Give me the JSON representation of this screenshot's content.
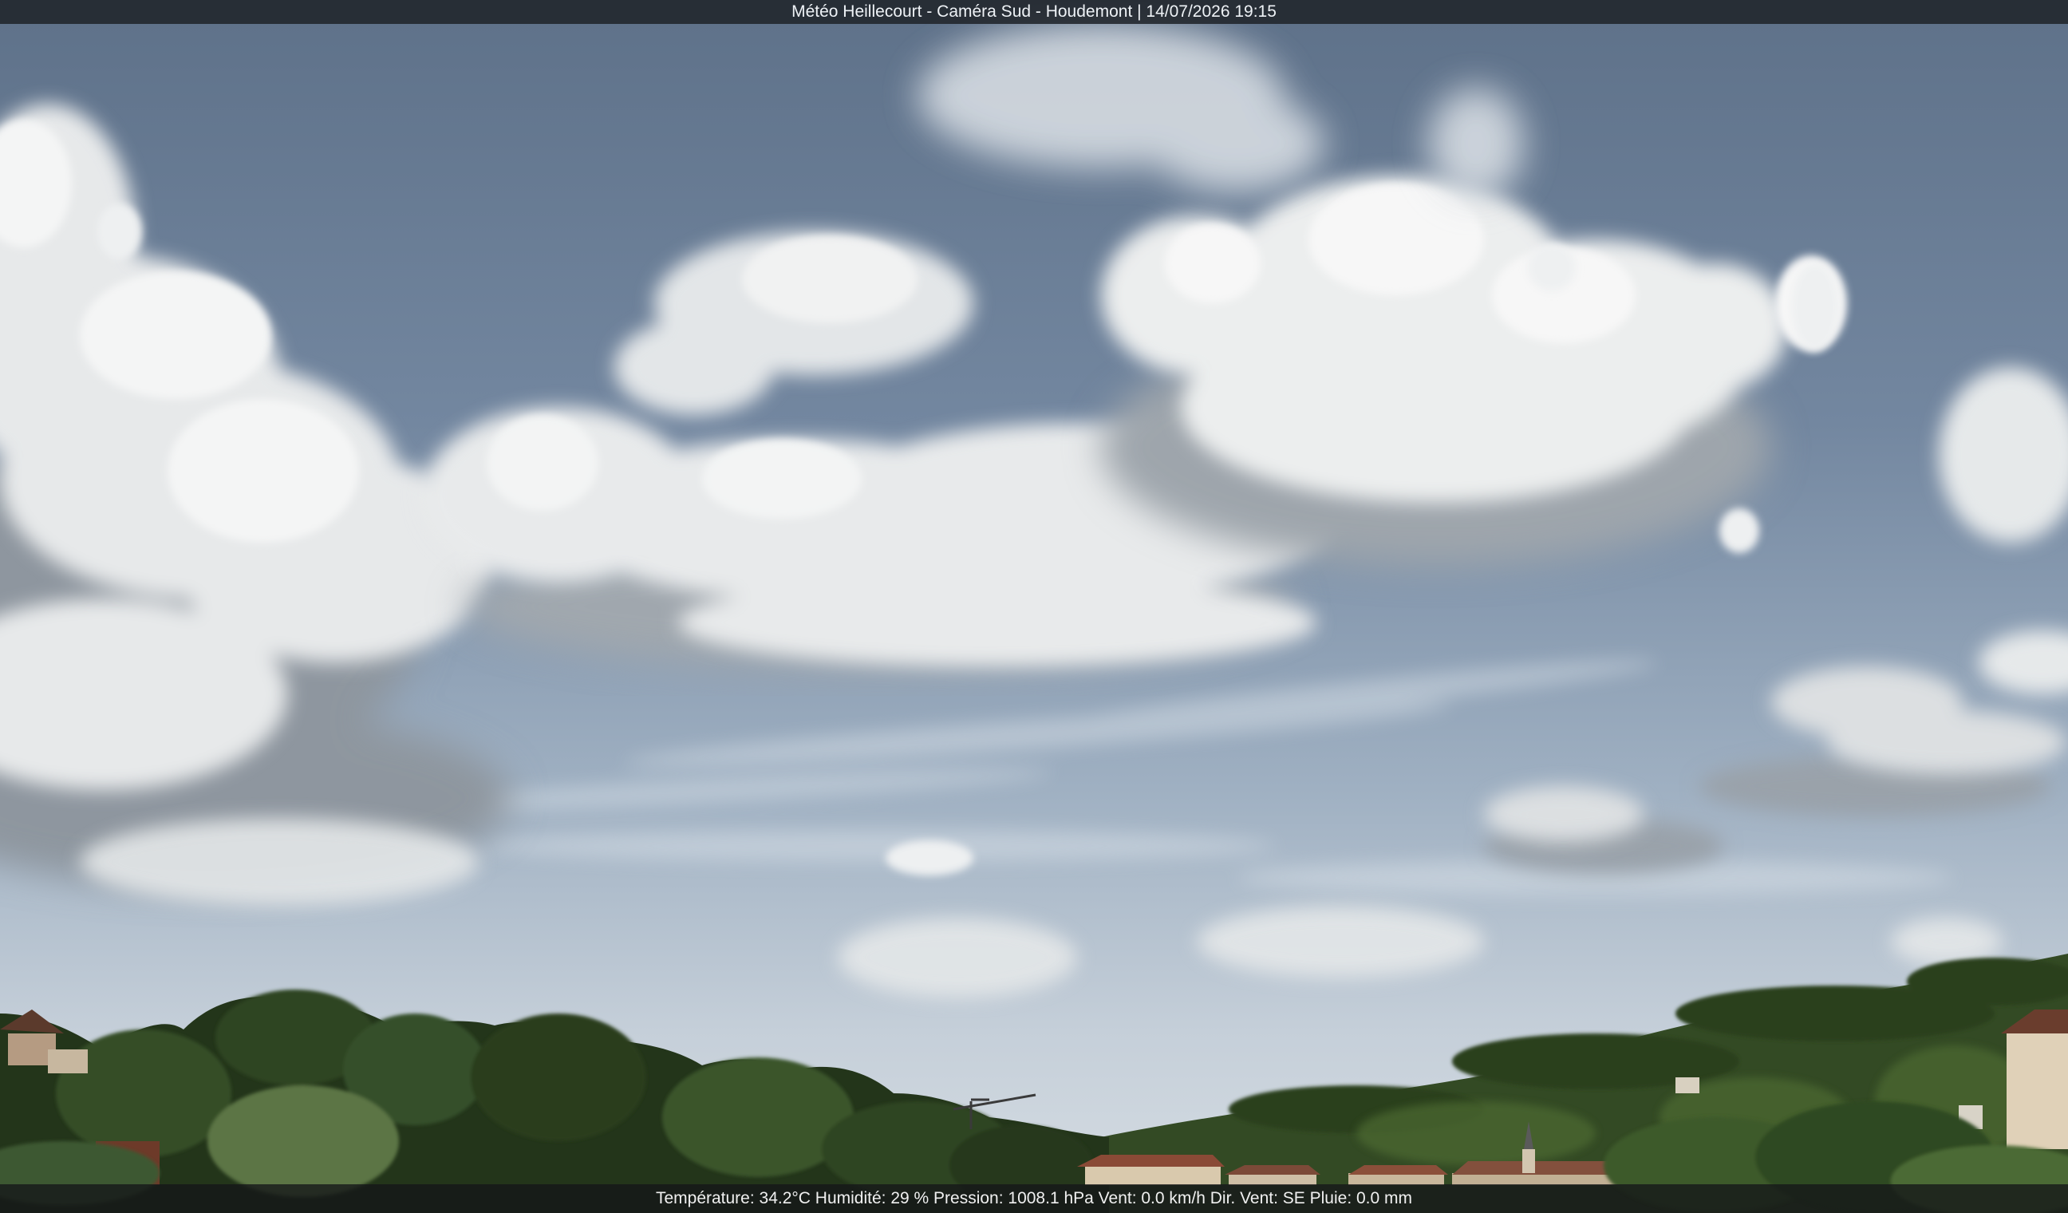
{
  "overlay": {
    "title": "Météo Heillecourt - Caméra Sud - Houdemont | 14/07/2026 19:15",
    "readings": "Température: 34.2°C  Humidité: 29 % Pression: 1008.1 hPa Vent: 0.0 km/h Dir. Vent: SE Pluie: 0.0 mm"
  },
  "scene": {
    "subject": "sky-with-cumulus-clouds",
    "colors": {
      "sky_top": "#5f728b",
      "sky_horizon": "#c9d3dc",
      "cloud": "#eef0f1",
      "cloud_shadow": "#9aa2ab",
      "foliage_dark": "#1f2c17",
      "foliage": "#3e5a2a",
      "roof": "#8a4a36",
      "wall": "#d9ccb4"
    }
  }
}
